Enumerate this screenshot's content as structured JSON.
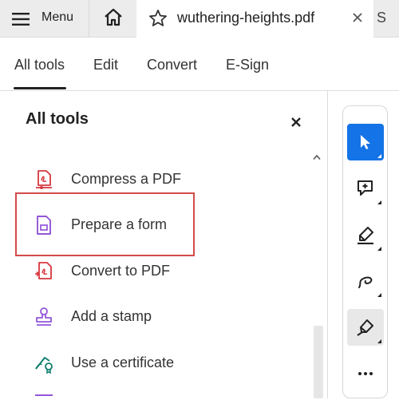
{
  "topbar": {
    "menu_label": "Menu",
    "tab_title": "wuthering-heights.pdf",
    "next_tab_initial": "S"
  },
  "nav": {
    "items": [
      {
        "label": "All tools",
        "active": true
      },
      {
        "label": "Edit"
      },
      {
        "label": "Convert"
      },
      {
        "label": "E-Sign"
      }
    ]
  },
  "panel": {
    "title": "All tools",
    "tools": [
      {
        "label": "Compress a PDF",
        "icon": "compress-pdf-icon",
        "color": "#d7373f"
      },
      {
        "label": "Prepare a form",
        "icon": "prepare-form-icon",
        "color": "#9256d9",
        "highlighted": true
      },
      {
        "label": "Convert to PDF",
        "icon": "convert-pdf-icon",
        "color": "#d7373f"
      },
      {
        "label": "Add a stamp",
        "icon": "stamp-icon",
        "color": "#9256d9"
      },
      {
        "label": "Use a certificate",
        "icon": "certificate-icon",
        "color": "#0d7e6e"
      }
    ]
  },
  "right_toolbar": {
    "tools": [
      {
        "icon": "select-cursor-icon",
        "state": "selected"
      },
      {
        "icon": "add-comment-icon"
      },
      {
        "icon": "highlight-pen-icon"
      },
      {
        "icon": "freehand-draw-icon"
      },
      {
        "icon": "sign-pen-icon",
        "state": "active"
      },
      {
        "icon": "more-icon"
      }
    ]
  },
  "colors": {
    "accent": "#1473e6",
    "highlight_border": "#d44a4a",
    "tab_bar_bg": "#ececec"
  }
}
